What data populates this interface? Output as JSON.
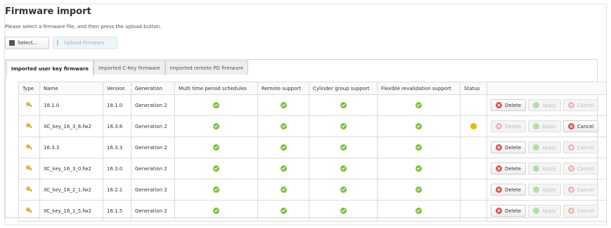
{
  "header": {
    "title": "Firmware import",
    "subtitle": "Please select a firmware file, and then press the upload button."
  },
  "toolbar": {
    "select_label": "Select...",
    "upload_label": "Upload firmware"
  },
  "tabs": [
    {
      "label": "Imported user key firmware",
      "active": true
    },
    {
      "label": "Imported C-Key firmware",
      "active": false
    },
    {
      "label": "Imported remote PD firmware",
      "active": false
    }
  ],
  "table": {
    "columns": [
      "Type",
      "Name",
      "Version",
      "Generation",
      "Multi time period schedules",
      "Remote support",
      "Cylinder group support",
      "Flexible revalidation support",
      "Status",
      ""
    ],
    "rows": [
      {
        "name": "18.1.0",
        "version": "18.1.0",
        "generation": "Generation 2",
        "status": "",
        "delete_enabled": true,
        "apply_enabled": false,
        "cancel_enabled": false
      },
      {
        "name": "XC_key_16_3_6.fw2",
        "version": "16.3.6",
        "generation": "Generation 2",
        "status": "pending",
        "delete_enabled": false,
        "apply_enabled": false,
        "cancel_enabled": true
      },
      {
        "name": "16.3.3",
        "version": "16.3.3",
        "generation": "Generation 2",
        "status": "",
        "delete_enabled": true,
        "apply_enabled": false,
        "cancel_enabled": false
      },
      {
        "name": "XC_key_16_3_0.fw2",
        "version": "16.3.0",
        "generation": "Generation 2",
        "status": "",
        "delete_enabled": true,
        "apply_enabled": false,
        "cancel_enabled": false
      },
      {
        "name": "XC_key_16_2_1.fw2",
        "version": "16.2.1",
        "generation": "Generation 2",
        "status": "",
        "delete_enabled": true,
        "apply_enabled": false,
        "cancel_enabled": false
      },
      {
        "name": "XC_key_16_1_5.fw2",
        "version": "16.1.5",
        "generation": "Generation 2",
        "status": "",
        "delete_enabled": true,
        "apply_enabled": false,
        "cancel_enabled": false
      }
    ]
  },
  "actions": {
    "delete_label": "Delete",
    "apply_label": "Apply",
    "cancel_label": "Cancel"
  },
  "icons": {
    "type": "key-icon",
    "feature_supported": "check-circle-icon",
    "status_pending": "pending-icon"
  },
  "colors": {
    "check_green": "#7fbf3a",
    "delete_red": "#d9534f",
    "pending_yellow": "#e6b800"
  }
}
